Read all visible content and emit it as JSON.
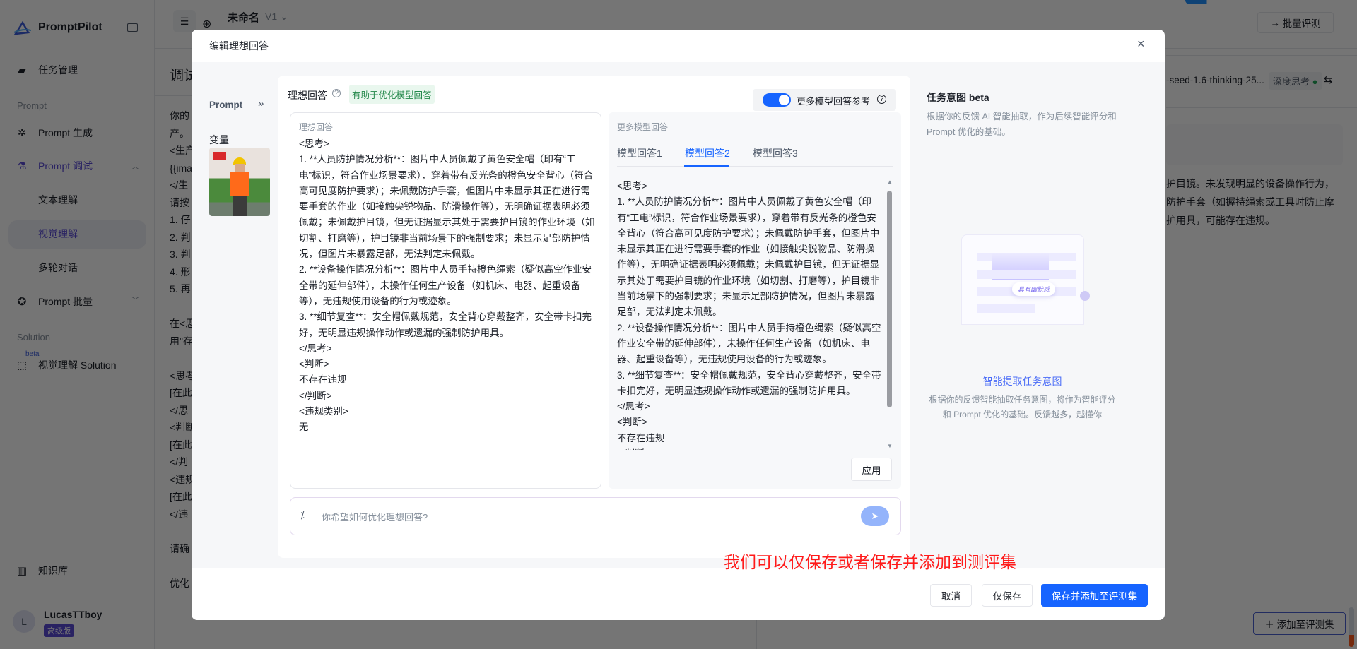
{
  "sidebar": {
    "brand": "PromptPilot",
    "task_mgmt": "任务管理",
    "section_prompt": "Prompt",
    "prompt_gen": "Prompt 生成",
    "prompt_debug": "Prompt 调试",
    "sub_text": "文本理解",
    "sub_vision": "视觉理解",
    "sub_multi": "多轮对话",
    "prompt_batch": "Prompt 批量",
    "section_solution": "Solution",
    "beta": "beta",
    "vision_solution": "视觉理解 Solution",
    "knowledge": "知识库",
    "user_initial": "L",
    "user_name": "LucasTTboy",
    "user_badge": "高级版"
  },
  "topbar": {
    "title": "未命名",
    "version": "V1",
    "batch_eval": "批量评测",
    "model": "-seed-1.6-thinking-25...",
    "deep_think": "深度思考",
    "add_to_eval": "添加至评测集"
  },
  "background": {
    "heading": "调试",
    "left_lines": [
      "你的",
      "产。",
      "<生产",
      "{{ima",
      "</生",
      "请按",
      "1. 仔",
      "2. 判",
      "3. 判",
      "4. 形",
      "5. 再",
      "",
      "在<思",
      "用\"存",
      "",
      "<思考",
      "[在此",
      "</思",
      "<判断",
      "[在此",
      "</判",
      "<违规",
      "[在此",
      "</违",
      "",
      "请确",
      "",
      "优化"
    ],
    "right_lines": [
      "护目镜。未发现明显的设备操作行为，",
      "防护手套（如握持绳索或工具时防止摩",
      "护用具，可能存在违规。"
    ]
  },
  "modal": {
    "title": "编辑理想回答",
    "prompt_label": "Prompt",
    "variables_label": "变量",
    "ideal_label": "理想回答",
    "ideal_tag": "有助于优化模型回答",
    "toggle_label": "更多模型回答参考",
    "toggle_on": true,
    "ideal_box_label": "理想回答",
    "ideal_content": "<思考>\n1. **人员防护情况分析**：图片中人员佩戴了黄色安全帽（印有“工电”标识，符合作业场景要求），穿着带有反光条的橙色安全背心（符合高可见度防护要求）；未佩戴防护手套，但图片中未显示其正在进行需要手套的作业（如接触尖锐物品、防滑操作等），无明确证据表明必须佩戴；未佩戴护目镜，但无证据显示其处于需要护目镜的作业环境（如切割、打磨等），护目镜非当前场景下的强制要求；未显示足部防护情况，但图片未暴露足部，无法判定未佩戴。\n2. **设备操作情况分析**：图片中人员手持橙色绳索（疑似高空作业安全带的延伸部件），未操作任何生产设备（如机床、电器、起重设备等），无违规使用设备的行为或迹象。\n3. **细节复查**：安全帽佩戴规范，安全背心穿戴整齐，安全带卡扣完好，无明显违规操作动作或遗漏的强制防护用具。\n</思考>\n<判断>\n不存在违规\n</判断>\n<违规类别>\n无",
    "more_label": "更多模型回答",
    "tabs": [
      "模型回答1",
      "模型回答2",
      "模型回答3"
    ],
    "active_tab": 1,
    "model_content": "<思考>\n1. **人员防护情况分析**：图片中人员佩戴了黄色安全帽（印有“工电”标识，符合作业场景要求），穿着带有反光条的橙色安全背心（符合高可见度防护要求）；未佩戴防护手套，但图片中未显示其正在进行需要手套的作业（如接触尖锐物品、防滑操作等），无明确证据表明必须佩戴；未佩戴护目镜，但无证据显示其处于需要护目镜的作业环境（如切割、打磨等），护目镜非当前场景下的强制要求；未显示足部防护情况，但图片未暴露足部，无法判定未佩戴。\n2. **设备操作情况分析**：图片中人员手持橙色绳索（疑似高空作业安全带的延伸部件），未操作任何生产设备（如机床、电器、起重设备等），无违规使用设备的行为或迹象。\n3. **细节复查**：安全帽佩戴规范，安全背心穿戴整齐，安全带卡扣完好，无明显违规操作动作或遗漏的强制防护用具。\n</思考>\n<判断>\n不存在违规\n</判断>",
    "apply": "应用",
    "input_placeholder": "你希望如何优化理想回答?",
    "intent_title": "任务意图 beta",
    "intent_desc": "根据你的反馈 AI 智能抽取，作为后续智能评分和 Prompt 优化的基础。",
    "illus_bubble": "具有幽默感",
    "intent_cta": "智能提取任务意图",
    "intent_cta_desc": "根据你的反馈智能抽取任务意图，将作为智能评分和 Prompt 优化的基础。反馈越多，越懂你",
    "annotation": "我们可以仅保存或者保存并添加到测评集",
    "cancel": "取消",
    "save_only": "仅保存",
    "save_add": "保存并添加至评测集"
  },
  "colors": {
    "primary": "#1664ff",
    "sidebar_active": "#5a4bd6",
    "annotation": "#ff1a1a",
    "tag_bg": "#e9f7ee",
    "tag_text": "#23884a"
  }
}
